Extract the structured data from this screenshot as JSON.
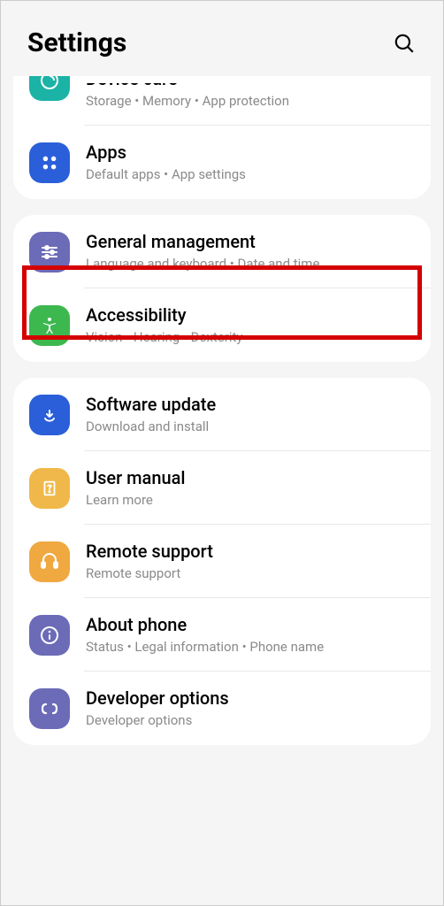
{
  "header": {
    "title": "Settings"
  },
  "groups": [
    {
      "items": [
        {
          "title": "Device care",
          "subtitle": "Storage  •  Memory  •  App protection"
        },
        {
          "title": "Apps",
          "subtitle": "Default apps  •  App settings"
        }
      ]
    },
    {
      "items": [
        {
          "title": "General management",
          "subtitle": "Language and keyboard  •  Date and time"
        },
        {
          "title": "Accessibility",
          "subtitle": "Vision  •  Hearing  •  Dexterity"
        }
      ]
    },
    {
      "items": [
        {
          "title": "Software update",
          "subtitle": "Download and install"
        },
        {
          "title": "User manual",
          "subtitle": "Learn more"
        },
        {
          "title": "Remote support",
          "subtitle": "Remote support"
        },
        {
          "title": "About phone",
          "subtitle": "Status  •  Legal information  •  Phone name"
        },
        {
          "title": "Developer options",
          "subtitle": "Developer options"
        }
      ]
    }
  ]
}
